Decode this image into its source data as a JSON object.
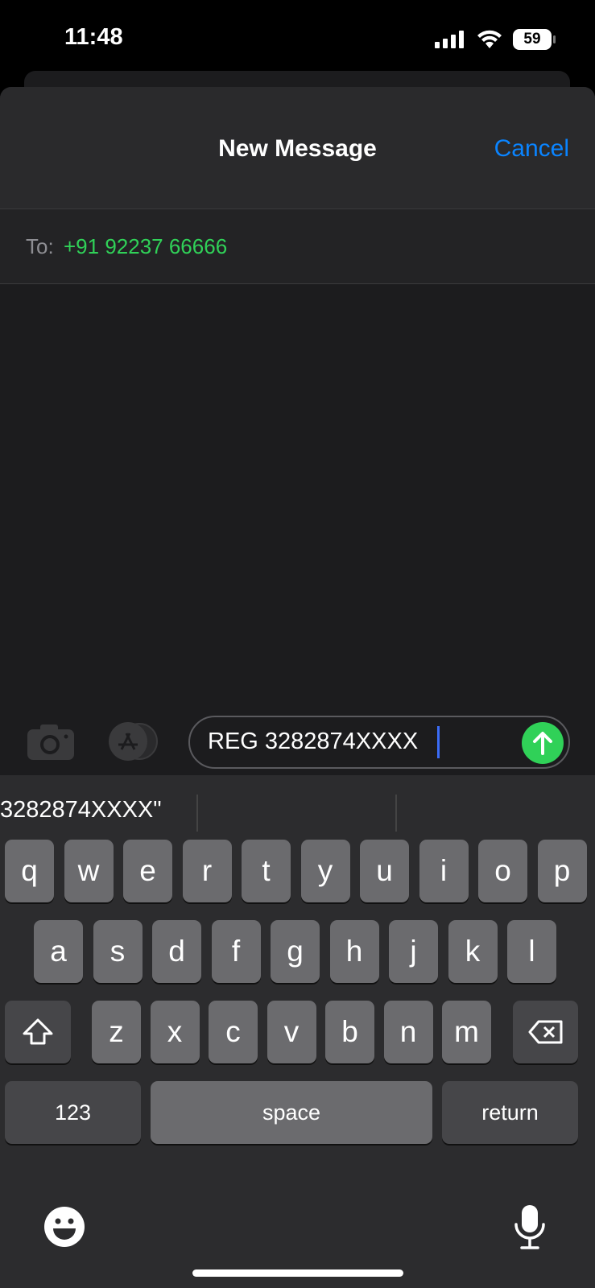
{
  "status": {
    "time": "11:48",
    "battery": "59"
  },
  "header": {
    "title": "New Message",
    "cancel": "Cancel"
  },
  "to": {
    "label": "To:",
    "value": "+91 92237 66666"
  },
  "composer": {
    "text": "REG 3282874XXXX"
  },
  "suggestion": {
    "text": "3282874XXXX\""
  },
  "colors": {
    "accent": "#0a84ff",
    "green": "#30d158"
  },
  "keyboard": {
    "row1": [
      "q",
      "w",
      "e",
      "r",
      "t",
      "y",
      "u",
      "i",
      "o",
      "p"
    ],
    "row2": [
      "a",
      "s",
      "d",
      "f",
      "g",
      "h",
      "j",
      "k",
      "l"
    ],
    "row3": [
      "z",
      "x",
      "c",
      "v",
      "b",
      "n",
      "m"
    ],
    "numbers": "123",
    "space": "space",
    "return": "return"
  }
}
